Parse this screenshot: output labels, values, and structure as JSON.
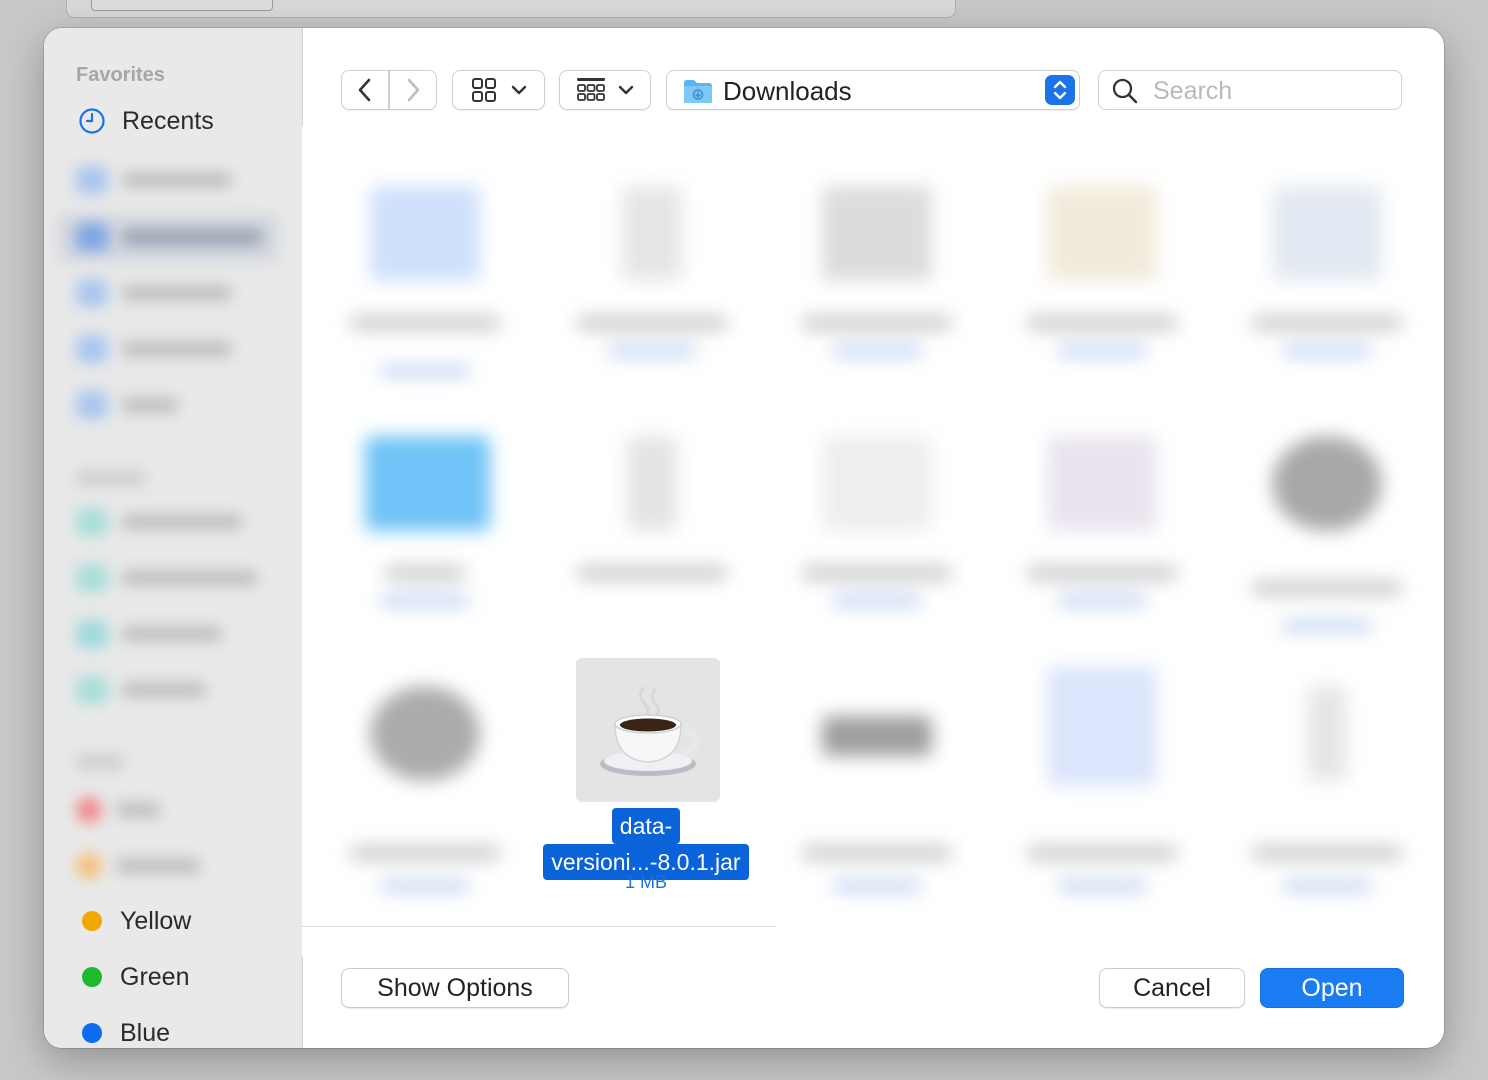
{
  "dialog": {
    "sidebar": {
      "favorites_heading": "Favorites",
      "recents_label": "Recents",
      "tags": [
        {
          "label": "Yellow",
          "color": "#f0a900"
        },
        {
          "label": "Green",
          "color": "#1eb92c"
        },
        {
          "label": "Blue",
          "color": "#0b6ef0"
        }
      ]
    },
    "toolbar": {
      "back": "‹",
      "forward": "›",
      "location": "Downloads",
      "search_placeholder": "Search"
    },
    "selected_file": {
      "name_line1": "data-",
      "name_line2": "versioni...-8.0.1.jar",
      "size": "1 MB"
    },
    "footer": {
      "show_options": "Show Options",
      "cancel": "Cancel",
      "open": "Open"
    },
    "colors": {
      "accent": "#1a7cf3",
      "selection": "#0a63d8"
    }
  }
}
